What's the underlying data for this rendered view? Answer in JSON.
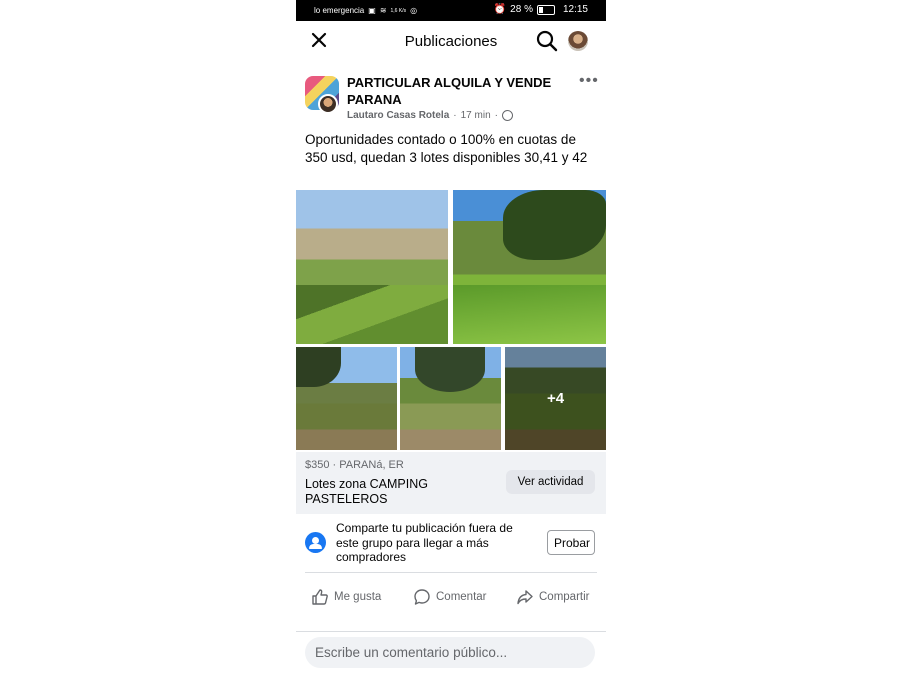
{
  "status_bar": {
    "left_text": "lo emergencia",
    "speed": "1,6 K/s",
    "battery": "28 %",
    "time": "12:15"
  },
  "header": {
    "title": "Publicaciones"
  },
  "post": {
    "group_name": "PARTICULAR ALQUILA Y VENDE PARANA",
    "author": "Lautaro Casas Rotela",
    "time": "17 min",
    "separator": "·",
    "text": "Oportunidades contado o 100% en cuotas de 350 usd, quedan 3 lotes disponibles 30,41 y 42",
    "more_photos": "+4"
  },
  "listing": {
    "price_location": "$350 · PARANá, ER",
    "title": "Lotes zona CAMPING PASTELEROS",
    "button": "Ver actividad"
  },
  "share": {
    "text": "Comparte tu publicación fuera de este grupo para llegar a más compradores",
    "button": "Probar"
  },
  "actions": {
    "like": "Me gusta",
    "comment": "Comentar",
    "share": "Compartir"
  },
  "comment": {
    "placeholder": "Escribe un comentario público..."
  }
}
